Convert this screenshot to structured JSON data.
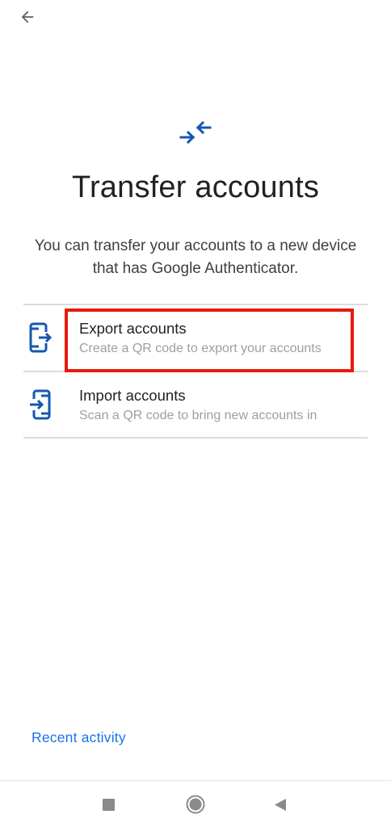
{
  "header": {
    "back_icon": "arrow-left-icon"
  },
  "hero": {
    "icon": "transfer-arrows-icon",
    "title": "Transfer accounts",
    "subtitle": "You can transfer your accounts to a new device that has Google Authenticator."
  },
  "options": [
    {
      "icon": "phone-export-icon",
      "title": "Export accounts",
      "description": "Create a QR code to export your accounts",
      "highlighted": true
    },
    {
      "icon": "phone-import-icon",
      "title": "Import accounts",
      "description": "Scan a QR code to bring new accounts in",
      "highlighted": false
    }
  ],
  "footer": {
    "recent_activity_label": "Recent activity"
  },
  "navbar": {
    "recents_icon": "square-recents-icon",
    "home_icon": "circle-home-icon",
    "back_icon": "triangle-back-icon"
  },
  "colors": {
    "accent": "#1a73e8",
    "icon_blue": "#1557b0",
    "highlight": "#e8190c",
    "divider": "#dadce0",
    "secondary_text": "#9aa0a6"
  }
}
